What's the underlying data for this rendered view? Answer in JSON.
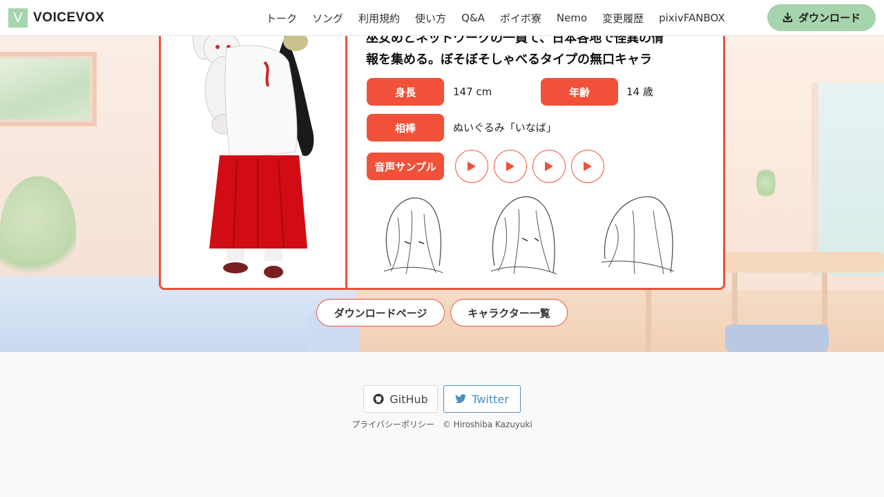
{
  "header": {
    "logo_letter": "V",
    "logo_text": "VOICEVOX",
    "nav": [
      "トーク",
      "ソング",
      "利用規約",
      "使い方",
      "Q&A",
      "ボイボ寮",
      "Nemo",
      "変更履歴",
      "pixivFANBOX"
    ],
    "download_label": "ダウンロード",
    "accent_color": "#a5d4ad"
  },
  "character": {
    "description_line1": "巫女めとネットワークの一員て、日本各地で怪異の情",
    "description_line2": "報を集める。ぼそぼそしゃべるタイプの無口キャラ",
    "height_label": "身長",
    "height_value": "147 cm",
    "age_label": "年齢",
    "age_value": "14 歳",
    "partner_label": "相棒",
    "partner_value": "ぬいぐるみ「いなば」",
    "voice_label": "音声サンプル",
    "play_icon": "play-icon",
    "accent_color": "#f05138"
  },
  "links": {
    "download_page": "ダウンロードページ",
    "character_list": "キャラクター一覧"
  },
  "footer": {
    "github": "GitHub",
    "twitter": "Twitter",
    "privacy": "プライバシーポリシー",
    "copyright": "© Hiroshiba Kazuyuki"
  }
}
